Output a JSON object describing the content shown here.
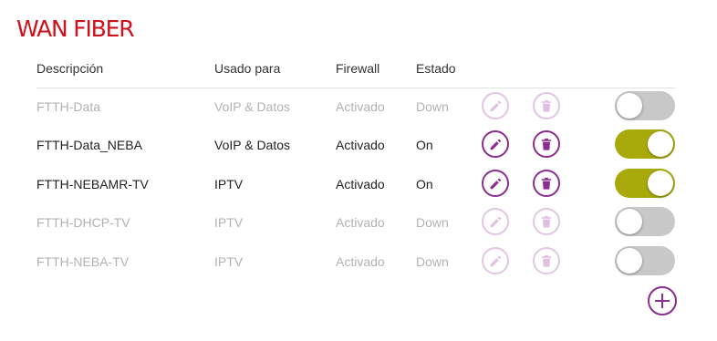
{
  "title": "WAN FIBER",
  "headers": {
    "description": "Descripción",
    "used_for": "Usado para",
    "firewall": "Firewall",
    "state": "Estado"
  },
  "rows": [
    {
      "description": "FTTH-Data",
      "used_for": "VoIP & Datos",
      "firewall": "Activado",
      "state": "Down",
      "enabled": false
    },
    {
      "description": "FTTH-Data_NEBA",
      "used_for": "VoIP & Datos",
      "firewall": "Activado",
      "state": "On",
      "enabled": true
    },
    {
      "description": "FTTH-NEBAMR-TV",
      "used_for": "IPTV",
      "firewall": "Activado",
      "state": "On",
      "enabled": true
    },
    {
      "description": "FTTH-DHCP-TV",
      "used_for": "IPTV",
      "firewall": "Activado",
      "state": "Down",
      "enabled": false
    },
    {
      "description": "FTTH-NEBA-TV",
      "used_for": "IPTV",
      "firewall": "Activado",
      "state": "Down",
      "enabled": false
    }
  ],
  "colors": {
    "title": "#d0111b",
    "accent": "#8b2d8f",
    "toggle_on": "#a8aa0c",
    "toggle_off": "#c8c8c8"
  },
  "icons": {
    "edit": "pencil-icon",
    "delete": "trash-icon",
    "add": "plus-icon"
  }
}
